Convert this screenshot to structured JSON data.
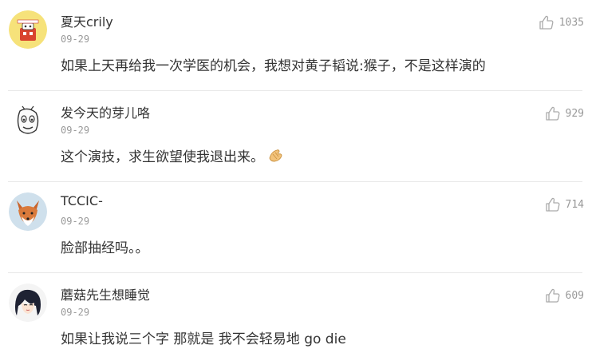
{
  "comments": [
    {
      "username": "夏天crily",
      "date": "09-29",
      "content": "如果上天再给我一次学医的机会，我想对黄子韬说:猴子，不是这样演的",
      "likes": "1035",
      "avatar_icon": "yellow-robot-avatar"
    },
    {
      "username": "发今天的芽儿咯",
      "date": "09-29",
      "content": "这个演技，求生欲望使我退出来。",
      "likes": "929",
      "avatar_icon": "cartoon-face-avatar"
    },
    {
      "username": "TCCIC-",
      "date": "09-29",
      "content": "脸部抽经吗。。",
      "likes": "714",
      "avatar_icon": "fox-avatar"
    },
    {
      "username": "蘑菇先生想睡觉",
      "date": "09-29",
      "content": "如果让我说三个字 那就是 我不会轻易地 go die",
      "likes": "609",
      "avatar_icon": "anime-girl-avatar"
    }
  ],
  "colors": {
    "username": "#333333",
    "date": "#999999",
    "like_icon": "#aaaaaa",
    "divider": "#e8e8e8"
  }
}
